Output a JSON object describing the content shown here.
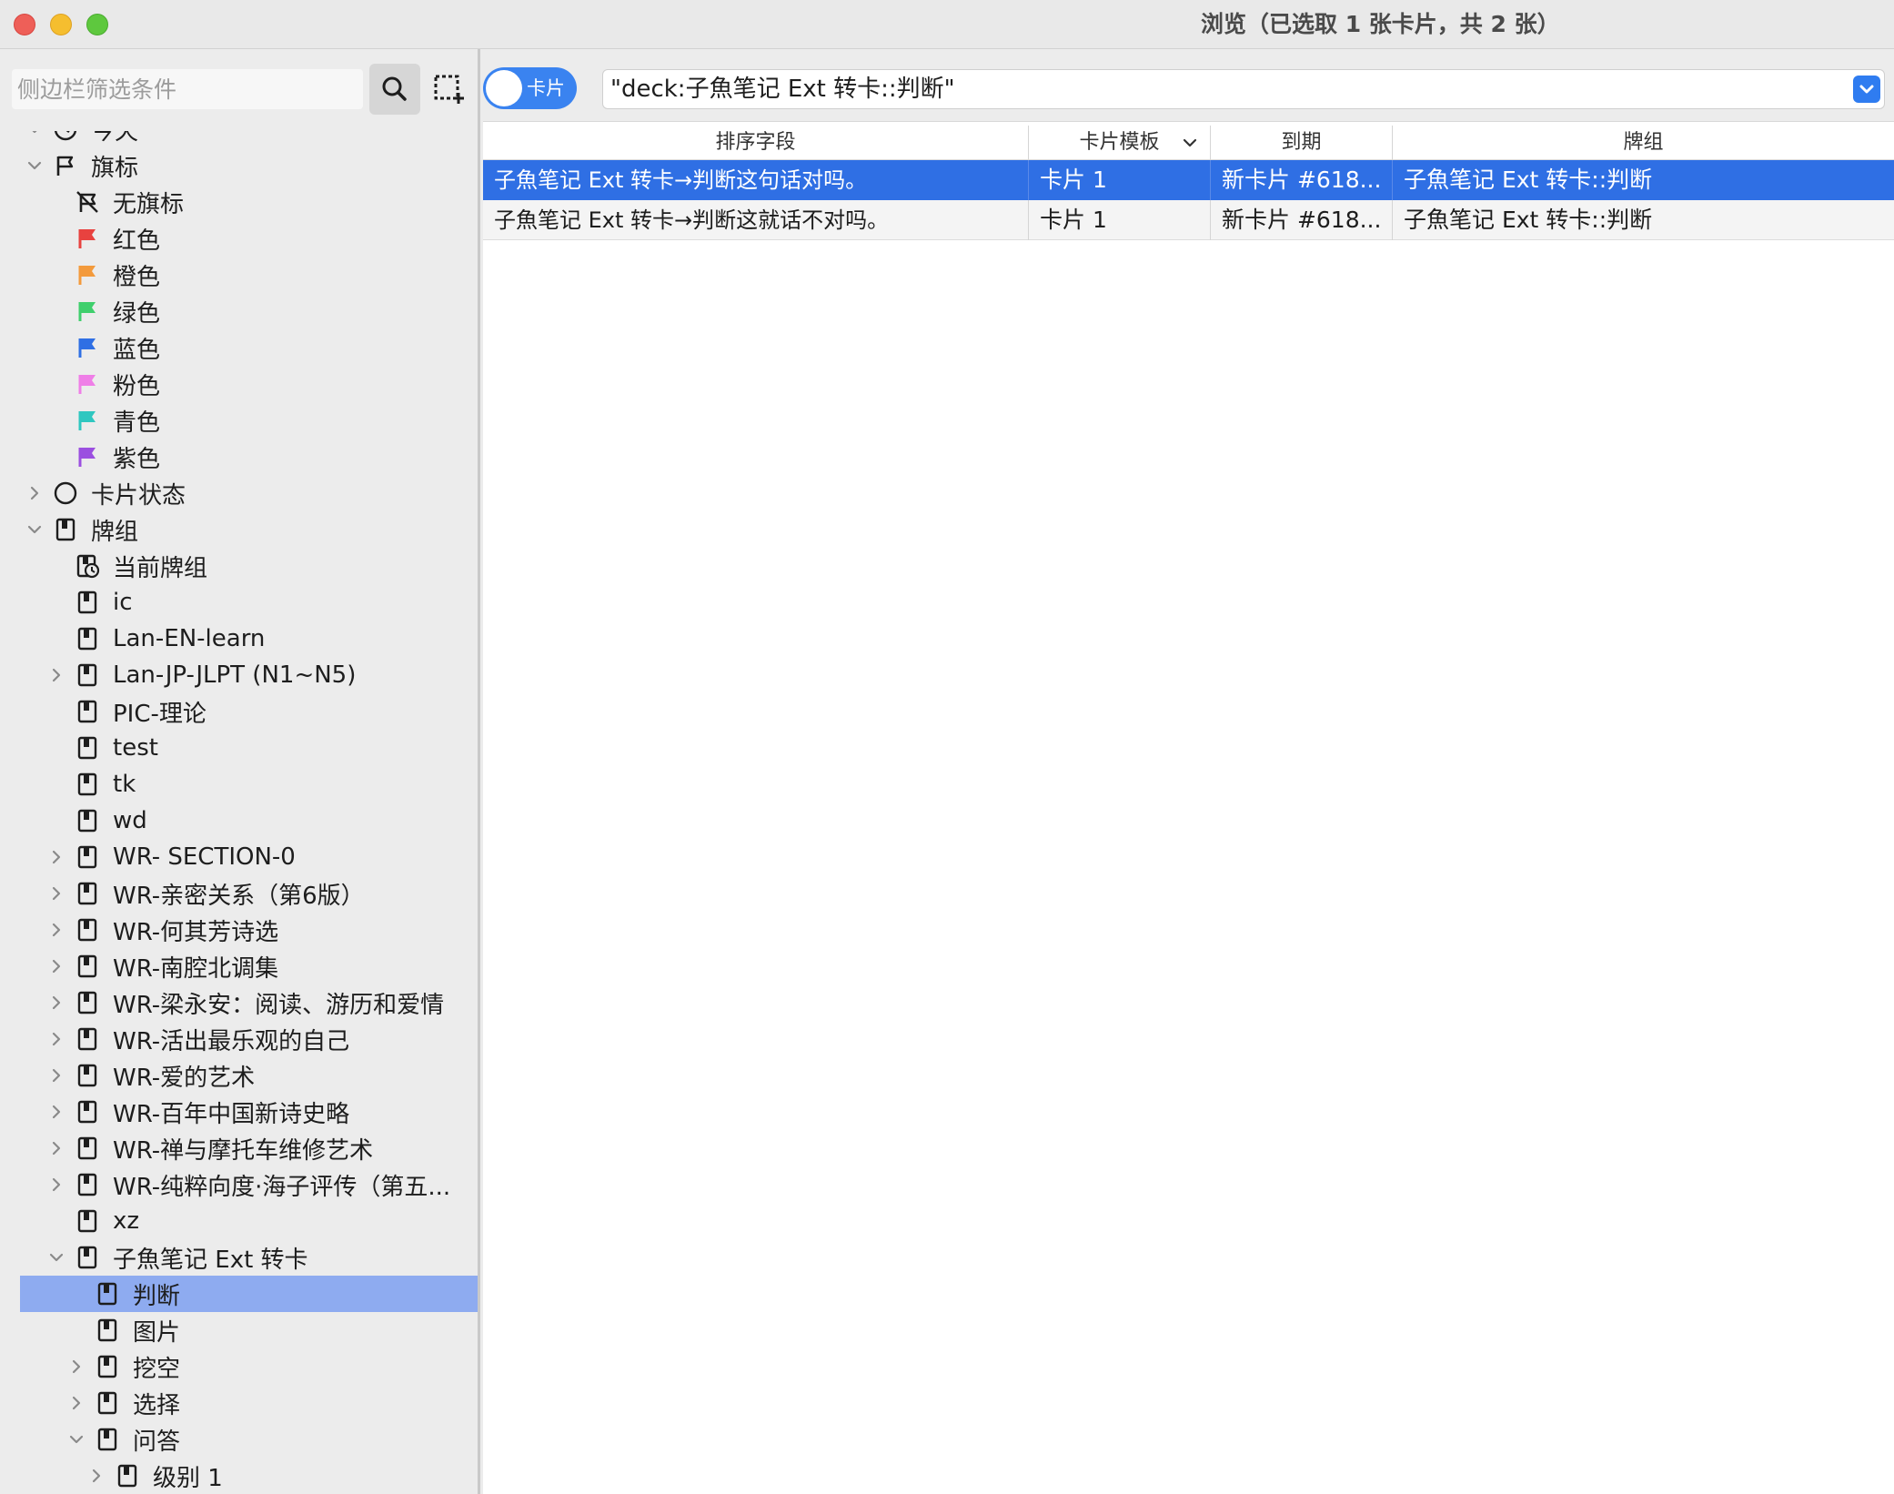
{
  "window": {
    "title": "浏览（已选取 1 张卡片，共 2 张）"
  },
  "sidebar": {
    "search_placeholder": "侧边栏筛选条件",
    "items": [
      {
        "label": "今天",
        "level": 1,
        "chevron": "down",
        "icon": "clock"
      },
      {
        "label": "旗标",
        "level": 1,
        "chevron": "down",
        "icon": "flag-outline"
      },
      {
        "label": "无旗标",
        "level": 2,
        "chevron": "",
        "icon": "flag-off"
      },
      {
        "label": "红色",
        "level": 2,
        "chevron": "",
        "icon": "flag",
        "color": "#e8423f"
      },
      {
        "label": "橙色",
        "level": 2,
        "chevron": "",
        "icon": "flag",
        "color": "#f39a3c"
      },
      {
        "label": "绿色",
        "level": 2,
        "chevron": "",
        "icon": "flag",
        "color": "#3fcf6c"
      },
      {
        "label": "蓝色",
        "level": 2,
        "chevron": "",
        "icon": "flag",
        "color": "#2f6fe4"
      },
      {
        "label": "粉色",
        "level": 2,
        "chevron": "",
        "icon": "flag",
        "color": "#ef7ee7"
      },
      {
        "label": "青色",
        "level": 2,
        "chevron": "",
        "icon": "flag",
        "color": "#2fc7c0"
      },
      {
        "label": "紫色",
        "level": 2,
        "chevron": "",
        "icon": "flag",
        "color": "#9b4fe0"
      },
      {
        "label": "卡片状态",
        "level": 1,
        "chevron": "right",
        "icon": "circle"
      },
      {
        "label": "牌组",
        "level": 1,
        "chevron": "down",
        "icon": "deck"
      },
      {
        "label": "当前牌组",
        "level": 2,
        "chevron": "",
        "icon": "deck-clock"
      },
      {
        "label": "ic",
        "level": 2,
        "chevron": "",
        "icon": "deck"
      },
      {
        "label": "Lan-EN-learn",
        "level": 2,
        "chevron": "",
        "icon": "deck"
      },
      {
        "label": "Lan-JP-JLPT (N1~N5)",
        "level": 2,
        "chevron": "right",
        "icon": "deck"
      },
      {
        "label": "PIC-理论",
        "level": 2,
        "chevron": "",
        "icon": "deck"
      },
      {
        "label": "test",
        "level": 2,
        "chevron": "",
        "icon": "deck"
      },
      {
        "label": "tk",
        "level": 2,
        "chevron": "",
        "icon": "deck"
      },
      {
        "label": "wd",
        "level": 2,
        "chevron": "",
        "icon": "deck"
      },
      {
        "label": "WR- SECTION-0",
        "level": 2,
        "chevron": "right",
        "icon": "deck"
      },
      {
        "label": "WR-亲密关系（第6版）",
        "level": 2,
        "chevron": "right",
        "icon": "deck"
      },
      {
        "label": "WR-何其芳诗选",
        "level": 2,
        "chevron": "right",
        "icon": "deck"
      },
      {
        "label": "WR-南腔北调集",
        "level": 2,
        "chevron": "right",
        "icon": "deck"
      },
      {
        "label": "WR-梁永安：阅读、游历和爱情",
        "level": 2,
        "chevron": "right",
        "icon": "deck"
      },
      {
        "label": "WR-活出最乐观的自己",
        "level": 2,
        "chevron": "right",
        "icon": "deck"
      },
      {
        "label": "WR-爱的艺术",
        "level": 2,
        "chevron": "right",
        "icon": "deck"
      },
      {
        "label": "WR-百年中国新诗史略",
        "level": 2,
        "chevron": "right",
        "icon": "deck"
      },
      {
        "label": "WR-禅与摩托车维修艺术",
        "level": 2,
        "chevron": "right",
        "icon": "deck"
      },
      {
        "label": "WR-纯粹向度·海子评传（第五...",
        "level": 2,
        "chevron": "right",
        "icon": "deck"
      },
      {
        "label": "xz",
        "level": 2,
        "chevron": "",
        "icon": "deck"
      },
      {
        "label": "子魚笔记 Ext 转卡",
        "level": 2,
        "chevron": "down",
        "icon": "deck"
      },
      {
        "label": "判断",
        "level": 3,
        "chevron": "",
        "icon": "deck",
        "selected": true
      },
      {
        "label": "图片",
        "level": 3,
        "chevron": "",
        "icon": "deck"
      },
      {
        "label": "挖空",
        "level": 3,
        "chevron": "right",
        "icon": "deck"
      },
      {
        "label": "选择",
        "level": 3,
        "chevron": "right",
        "icon": "deck"
      },
      {
        "label": "问答",
        "level": 3,
        "chevron": "down",
        "icon": "deck"
      },
      {
        "label": "级别 1",
        "level": 4,
        "chevron": "right",
        "icon": "deck"
      }
    ]
  },
  "toolbar": {
    "toggle_label": "卡片",
    "query": "\"deck:子魚笔记 Ext 转卡::判断\""
  },
  "table": {
    "columns": [
      "排序字段",
      "卡片模板",
      "到期",
      "牌组"
    ],
    "rows": [
      {
        "sort_field": "子魚笔记 Ext 转卡→判断这句话对吗。",
        "template": "卡片 1",
        "due": "新卡片 #618...",
        "deck": "子魚笔记 Ext 转卡::判断",
        "selected": true
      },
      {
        "sort_field": "子魚笔记 Ext 转卡→判断这就话不对吗。",
        "template": "卡片 1",
        "due": "新卡片 #618...",
        "deck": "子魚笔记 Ext 转卡::判断",
        "selected": false
      }
    ]
  },
  "colors": {
    "accent": "#2f6fe4",
    "sidebar_selected": "#8eabf0"
  }
}
